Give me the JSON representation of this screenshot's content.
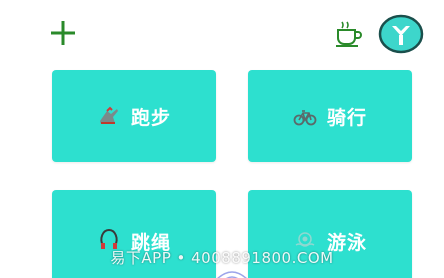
{
  "header": {
    "add_icon": "plus-icon",
    "cup_icon": "coffee-cup-icon",
    "avatar_icon": "avatar-logo-icon"
  },
  "colors": {
    "accent_green": "#2a8a2a",
    "card_teal": "#2de0cf",
    "avatar_teal": "#3dd6cb"
  },
  "activities": [
    {
      "label": "跑步",
      "icon": "running-shoe-icon"
    },
    {
      "label": "骑行",
      "icon": "bicycle-icon"
    },
    {
      "label": "跳绳",
      "icon": "jump-rope-icon"
    },
    {
      "label": "游泳",
      "icon": "swimming-icon"
    }
  ],
  "watermark": "易下APP • 4008891800.COM"
}
